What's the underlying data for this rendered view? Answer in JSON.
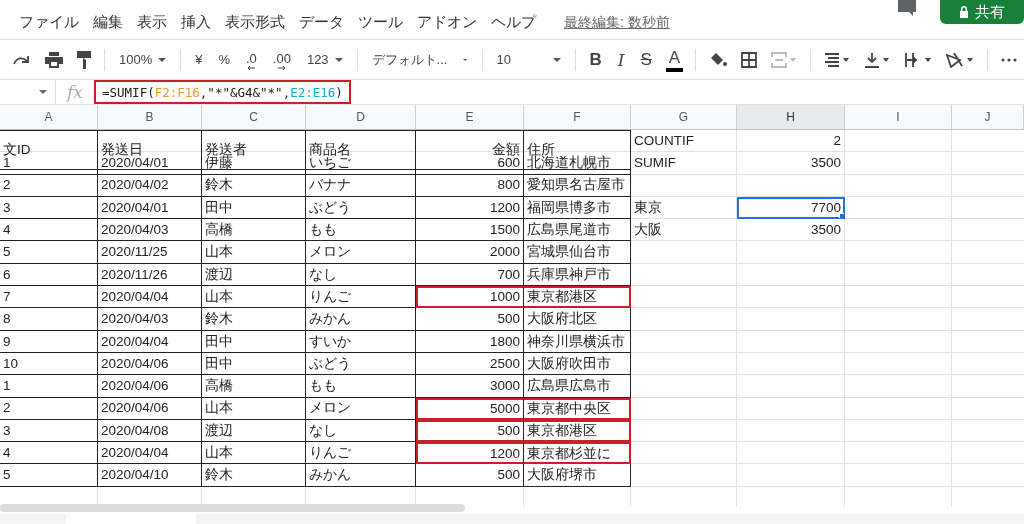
{
  "menu": {
    "items": [
      "ファイル",
      "編集",
      "表示",
      "挿入",
      "表示形式",
      "データ",
      "ツール",
      "アドオン",
      "ヘルプ"
    ],
    "last_edit": "最終編集: 数秒前"
  },
  "share_button": "共有",
  "toolbar": [
    {
      "kind": "redo"
    },
    {
      "kind": "print"
    },
    {
      "kind": "paint-format"
    },
    {
      "kind": "sep"
    },
    {
      "kind": "dropdown",
      "label": "100%"
    },
    {
      "kind": "sep"
    },
    {
      "kind": "text",
      "label": "¥"
    },
    {
      "kind": "text",
      "label": "%"
    },
    {
      "kind": "dec-left",
      "label": ".0"
    },
    {
      "kind": "dec-right",
      "label": ".00"
    },
    {
      "kind": "dropdown",
      "label": "123"
    },
    {
      "kind": "sep"
    },
    {
      "kind": "dropdown",
      "label": "デフォルト...",
      "wide": true
    },
    {
      "kind": "sep"
    },
    {
      "kind": "dropdown",
      "label": "10",
      "wide": true
    },
    {
      "kind": "sep"
    },
    {
      "kind": "bold",
      "label": "B"
    },
    {
      "kind": "italic",
      "label": "I"
    },
    {
      "kind": "strike",
      "label": "S"
    },
    {
      "kind": "textcolor",
      "label": "A"
    },
    {
      "kind": "sep"
    },
    {
      "kind": "fill"
    },
    {
      "kind": "borders"
    },
    {
      "kind": "merge",
      "disabled": true
    },
    {
      "kind": "sep"
    },
    {
      "kind": "halign"
    },
    {
      "kind": "valign"
    },
    {
      "kind": "wrap"
    },
    {
      "kind": "rotate"
    },
    {
      "kind": "sep"
    },
    {
      "kind": "more"
    }
  ],
  "formula_bar": {
    "fx_label": "fx",
    "outlined": true,
    "parts": [
      {
        "text": "=SUMIF("
      },
      {
        "text": "F2:F16",
        "color": "#f7981d"
      },
      {
        "text": ",\"*\"&G4&\"*\","
      },
      {
        "text": "E2:E16",
        "color": "#11a9cc"
      },
      {
        "text": ")"
      }
    ]
  },
  "columns": [
    {
      "label": "A",
      "selected": false
    },
    {
      "label": "B",
      "selected": false
    },
    {
      "label": "C",
      "selected": false
    },
    {
      "label": "D",
      "selected": false
    },
    {
      "label": "E",
      "selected": false
    },
    {
      "label": "F",
      "selected": false
    },
    {
      "label": "G",
      "selected": false
    },
    {
      "label": "H",
      "selected": true
    },
    {
      "label": "I",
      "selected": false
    },
    {
      "label": "J",
      "selected": false
    }
  ],
  "rows": [
    {
      "cells": {
        "A": "文ID",
        "B": "発送日",
        "C": "発送者",
        "D": "商品名",
        "E": "金額",
        "F": "住所",
        "G": "COUNTIF",
        "H": "2"
      },
      "outlined": false,
      "selected": false
    },
    {
      "cells": {
        "A": "1",
        "B": "2020/04/01",
        "C": "伊藤",
        "D": "いちご",
        "E": "600",
        "F": "北海道札幌市",
        "G": "SUMIF",
        "H": "3500"
      },
      "outlined": false,
      "selected": false
    },
    {
      "cells": {
        "A": "2",
        "B": "2020/04/02",
        "C": "鈴木",
        "D": "バナナ",
        "E": "800",
        "F": "愛知県名古屋市"
      },
      "outlined": false,
      "selected": false
    },
    {
      "cells": {
        "A": "3",
        "B": "2020/04/01",
        "C": "田中",
        "D": "ぶどう",
        "E": "1200",
        "F": "福岡県博多市",
        "G": "東京",
        "H": "7700"
      },
      "outlined": false,
      "selected": true
    },
    {
      "cells": {
        "A": "4",
        "B": "2020/04/03",
        "C": "高橋",
        "D": "もも",
        "E": "1500",
        "F": "広島県尾道市",
        "G": "大阪",
        "H": "3500"
      },
      "outlined": false,
      "selected": false
    },
    {
      "cells": {
        "A": "5",
        "B": "2020/11/25",
        "C": "山本",
        "D": "メロン",
        "E": "2000",
        "F": "宮城県仙台市"
      },
      "outlined": false,
      "selected": false
    },
    {
      "cells": {
        "A": "6",
        "B": "2020/11/26",
        "C": "渡辺",
        "D": "なし",
        "E": "700",
        "F": "兵庫県神戸市"
      },
      "outlined": false,
      "selected": false
    },
    {
      "cells": {
        "A": "7",
        "B": "2020/04/04",
        "C": "山本",
        "D": "りんご",
        "E": "1000",
        "F": "東京都港区"
      },
      "outlined": true,
      "selected": false
    },
    {
      "cells": {
        "A": "8",
        "B": "2020/04/03",
        "C": "鈴木",
        "D": "みかん",
        "E": "500",
        "F": "大阪府北区"
      },
      "outlined": false,
      "selected": false
    },
    {
      "cells": {
        "A": "9",
        "B": "2020/04/04",
        "C": "田中",
        "D": "すいか",
        "E": "1800",
        "F": "神奈川県横浜市"
      },
      "outlined": false,
      "selected": false
    },
    {
      "cells": {
        "A": "10",
        "B": "2020/04/06",
        "C": "田中",
        "D": "ぶどう",
        "E": "2500",
        "F": "大阪府吹田市"
      },
      "outlined": false,
      "selected": false
    },
    {
      "cells": {
        "A": "1",
        "B": "2020/04/06",
        "C": "高橋",
        "D": "もも",
        "E": "3000",
        "F": "広島県広島市"
      },
      "outlined": false,
      "selected": false
    },
    {
      "cells": {
        "A": "2",
        "B": "2020/04/06",
        "C": "山本",
        "D": "メロン",
        "E": "5000",
        "F": "東京都中央区"
      },
      "outlined": true,
      "selected": false
    },
    {
      "cells": {
        "A": "3",
        "B": "2020/04/08",
        "C": "渡辺",
        "D": "なし",
        "E": "500",
        "F": "東京都港区"
      },
      "outlined": true,
      "selected": false
    },
    {
      "cells": {
        "A": "4",
        "B": "2020/04/04",
        "C": "山本",
        "D": "りんご",
        "E": "1200",
        "F": "東京都杉並に"
      },
      "outlined": true,
      "selected": false
    },
    {
      "cells": {
        "A": "5",
        "B": "2020/04/10",
        "C": "鈴木",
        "D": "みかん",
        "E": "500",
        "F": "大阪府堺市"
      },
      "outlined": false,
      "selected": false
    }
  ]
}
